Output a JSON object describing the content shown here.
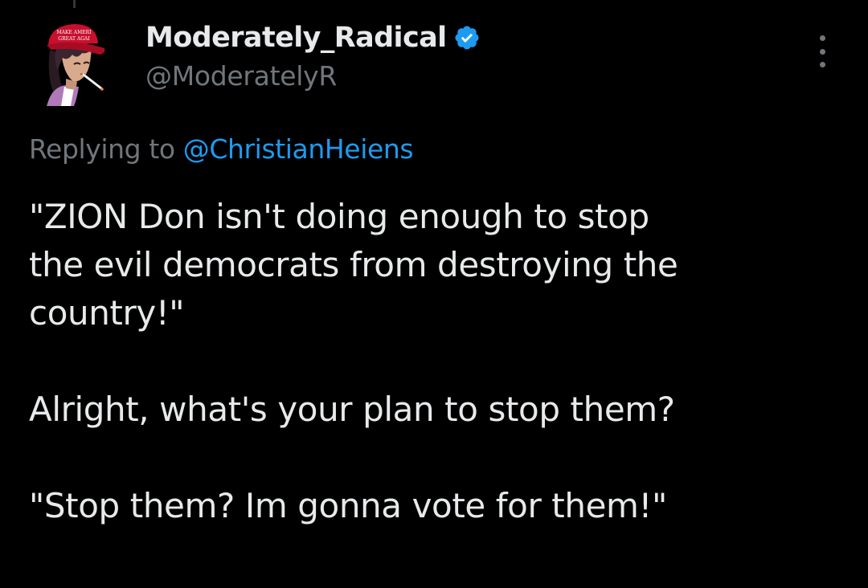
{
  "tweet": {
    "author": {
      "display_name": "Moderately_Radical",
      "handle": "@ModeratelyR",
      "verified": true,
      "avatar_icon": "maga-hat-avatar",
      "avatar_hat_text": [
        "MAKE AMERICA",
        "GREAT AGAIN"
      ]
    },
    "more_icon": "more-vertical-icon",
    "replying_to": {
      "prefix": "Replying to",
      "mention": "@ChristianHeiens"
    },
    "body": {
      "para1": {
        "line1": "\"ZION Don isn't doing enough to stop",
        "line2": "the evil democrats from destroying the",
        "line3": "country!\""
      },
      "para2": {
        "line1": "Alright, what's your plan to stop them?"
      },
      "para3": {
        "line1": "\"Stop them? Im gonna vote for them!\""
      }
    }
  },
  "colors": {
    "background": "#000000",
    "text_primary": "#e7e9ea",
    "text_secondary": "#71767b",
    "accent": "#1d9bf0"
  }
}
